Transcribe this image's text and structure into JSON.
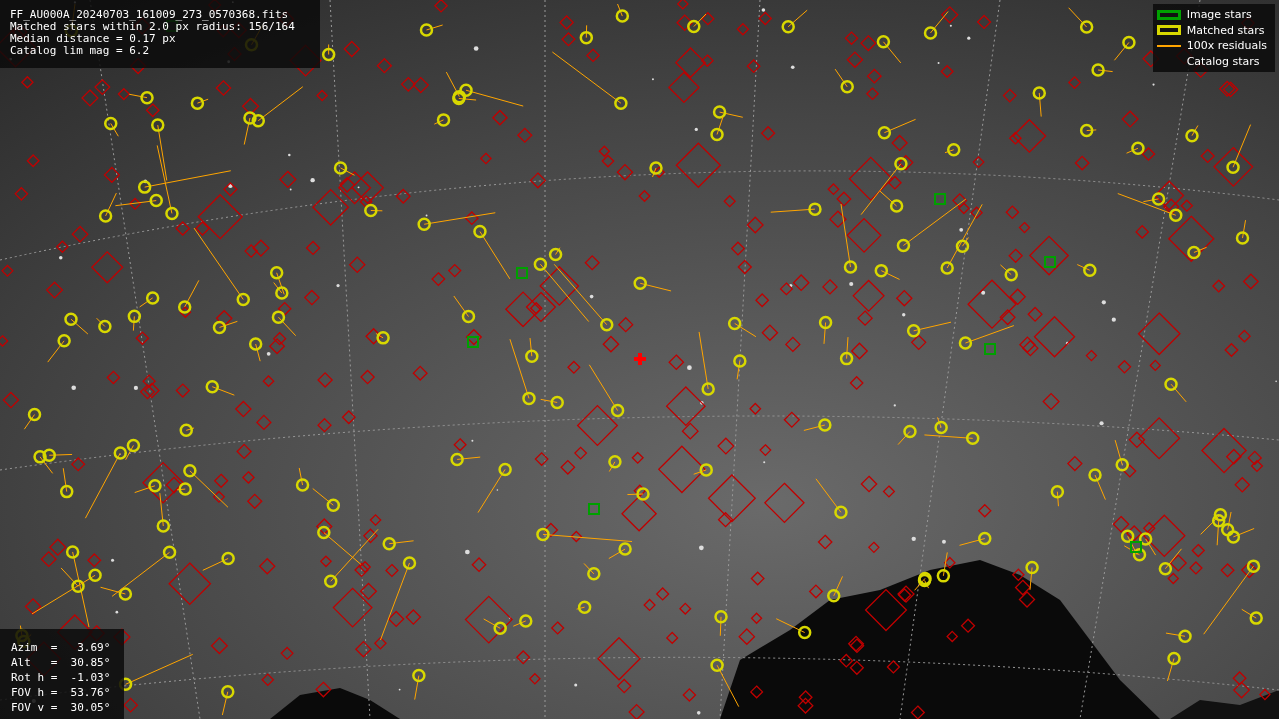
{
  "info": {
    "lines": [
      "FF_AU000A_20240703_161009_273_0570368.fits",
      "Matched stars within 2.0 px radius: 156/164",
      "Median distance = 0.17 px",
      "Catalog lim mag = 6.2"
    ]
  },
  "legend": [
    {
      "label": "Image stars"
    },
    {
      "kind": "matched",
      "label": "Matched stars"
    },
    {
      "kind": "residual",
      "label": "100x residuals"
    },
    {
      "kind": "catalog",
      "label": "Catalog stars"
    }
  ],
  "pointing": {
    "lines": [
      "Azim  =   3.69°",
      "Alt   =  30.85°",
      "Rot h =  -1.03°",
      "FOV h =  53.76°",
      "FOV v =  30.05°"
    ]
  }
}
